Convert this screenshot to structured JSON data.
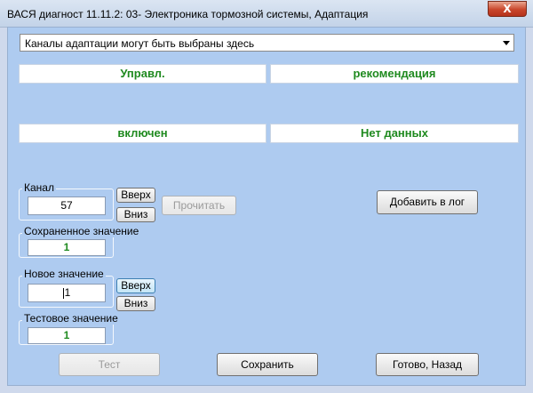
{
  "window": {
    "title": "ВАСЯ диагност 11.11.2: 03- Электроника тормозной системы, Адаптация",
    "close_glyph": "X"
  },
  "dropdown": {
    "selected": "Каналы адаптации могут быть выбраны здесь"
  },
  "fields": {
    "top_left": "Управл.",
    "top_right": "рекомендация",
    "bottom_left": "включен",
    "bottom_right": "Нет данных"
  },
  "channel": {
    "label": "Канал",
    "value": "57",
    "up_label": "Вверх",
    "down_label": "Вниз",
    "read_label": "Прочитать"
  },
  "saved_value": {
    "label": "Сохраненное значение",
    "value": "1"
  },
  "new_value": {
    "label": "Новое значение",
    "value": "1",
    "up_label": "Вверх",
    "down_label": "Вниз"
  },
  "test_value": {
    "label": "Тестовое значение",
    "value": "1"
  },
  "buttons": {
    "add_log": "Добавить в лог",
    "test": "Тест",
    "save": "Сохранить",
    "done": "Готово, Назад"
  }
}
